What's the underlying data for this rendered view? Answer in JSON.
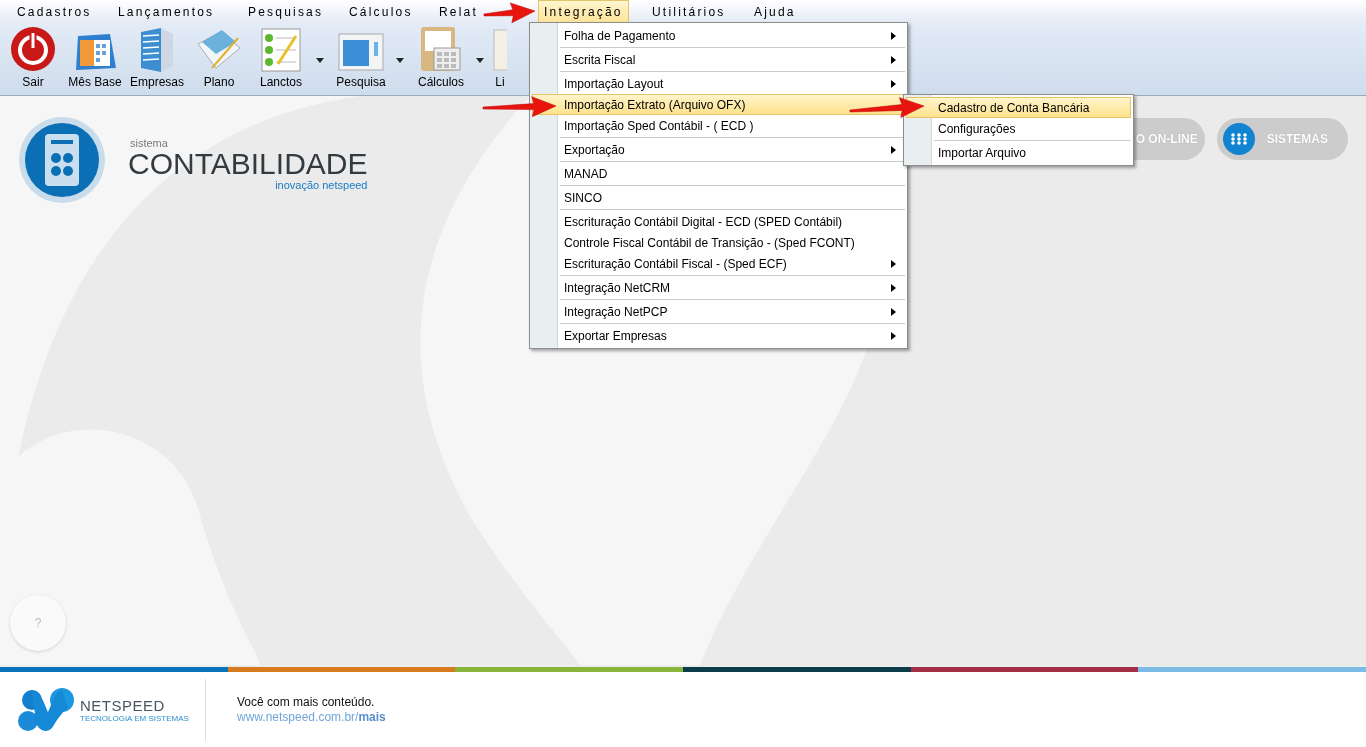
{
  "menu_bar": [
    {
      "label": "Cadastros",
      "selected": false
    },
    {
      "label": "Lançamentos",
      "selected": false
    },
    {
      "label": "Pesquisas",
      "selected": false
    },
    {
      "label": "Cálculos",
      "selected": false
    },
    {
      "label": "Relat",
      "selected": false
    },
    {
      "label": "Integração",
      "selected": true
    },
    {
      "label": "Utilitários",
      "selected": false
    },
    {
      "label": "Ajuda",
      "selected": false
    }
  ],
  "toolbar": [
    {
      "label": "Sair",
      "dropdown": false
    },
    {
      "label": "Mês Base",
      "dropdown": false
    },
    {
      "label": "Empresas",
      "dropdown": false
    },
    {
      "label": "Plano",
      "dropdown": false
    },
    {
      "label": "Lanctos",
      "dropdown": true
    },
    {
      "label": "Pesquisa",
      "dropdown": true
    },
    {
      "label": "Cálculos",
      "dropdown": true
    },
    {
      "label": "Li",
      "dropdown": false
    }
  ],
  "integration_menu": [
    [
      {
        "label": "Folha de Pagamento",
        "submenu": true,
        "selected": false
      }
    ],
    [
      {
        "label": "Escrita Fiscal",
        "submenu": true,
        "selected": false
      }
    ],
    [
      {
        "label": "Importação Layout",
        "submenu": true,
        "selected": false
      },
      {
        "label": "Importação Extrato (Arquivo OFX)",
        "submenu": false,
        "selected": true
      },
      {
        "label": "Importação Sped Contábil - ( ECD )",
        "submenu": false,
        "selected": false
      }
    ],
    [
      {
        "label": "Exportação",
        "submenu": true,
        "selected": false
      }
    ],
    [
      {
        "label": "MANAD",
        "submenu": false,
        "selected": false
      }
    ],
    [
      {
        "label": "SINCO",
        "submenu": false,
        "selected": false
      }
    ],
    [
      {
        "label": "Escrituração Contábil Digital - ECD (SPED Contábil)",
        "submenu": false,
        "selected": false
      },
      {
        "label": "Controle Fiscal Contábil de Transição - (Sped FCONT)",
        "submenu": false,
        "selected": false
      },
      {
        "label": "Escrituração Contábil Fiscal - (Sped ECF)",
        "submenu": true,
        "selected": false
      }
    ],
    [
      {
        "label": "Integração NetCRM",
        "submenu": true,
        "selected": false
      }
    ],
    [
      {
        "label": "Integração NetPCP",
        "submenu": true,
        "selected": false
      }
    ],
    [
      {
        "label": "Exportar Empresas",
        "submenu": true,
        "selected": false
      }
    ]
  ],
  "ofx_submenu": [
    [
      {
        "label": "Cadastro de Conta Bancária",
        "submenu": false,
        "selected": true
      },
      {
        "label": "Configurações",
        "submenu": false,
        "selected": false
      }
    ],
    [
      {
        "label": "Importar Arquivo",
        "submenu": false,
        "selected": false
      }
    ]
  ],
  "brand": {
    "prefix": "sistema",
    "name": "CONTABILIDADE",
    "tagline": "inovação netspeed"
  },
  "header_buttons": [
    {
      "label": "O ON-LINE",
      "kind": "plain"
    },
    {
      "label": "SISTEMAS",
      "kind": "icon"
    }
  ],
  "help_button": {
    "label": "?"
  },
  "color_stripe": [
    {
      "color": "#0a72b9"
    },
    {
      "color": "#d67b1f"
    },
    {
      "color": "#8ab53d"
    },
    {
      "color": "#0d3b4a"
    },
    {
      "color": "#a52f48"
    },
    {
      "color": "#7cbbe6"
    }
  ],
  "footer": {
    "logo_name": "NETSPEED",
    "logo_tagline": "TECNOLOGIA EM SISTEMAS",
    "message": "Você com mais conteúdo.",
    "link": "www.netspeed.com.br/**mais**"
  }
}
